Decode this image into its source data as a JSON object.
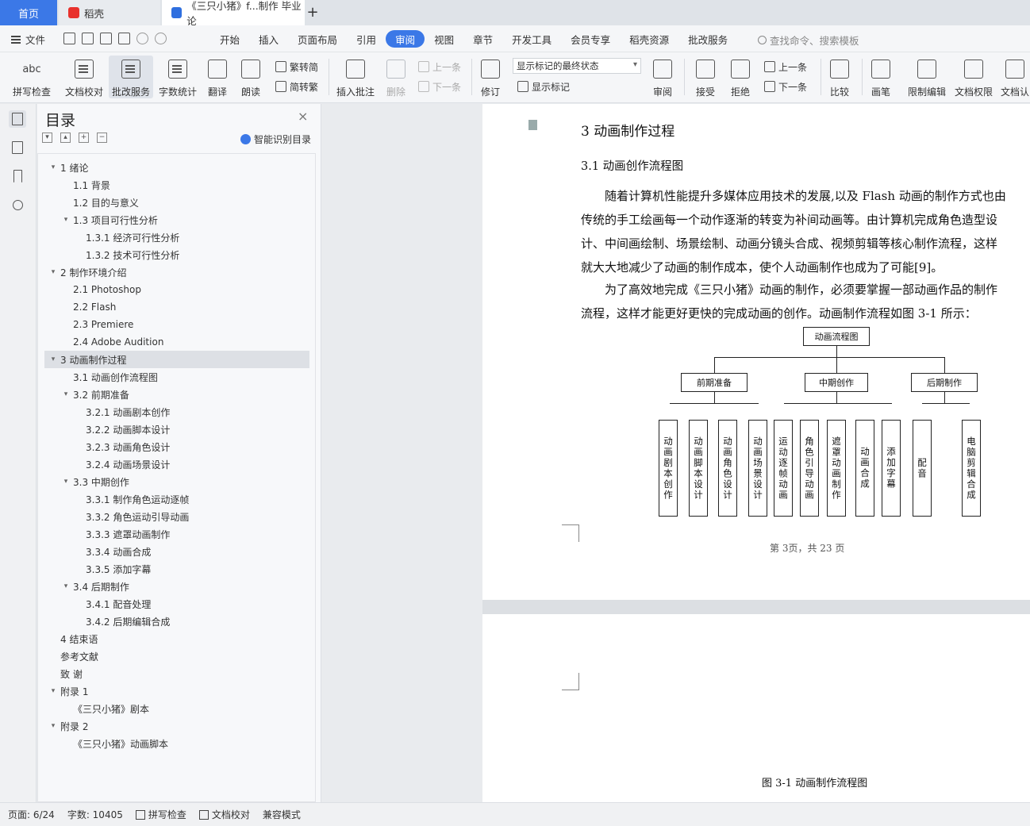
{
  "tabs": {
    "home": "首页",
    "docer": "稻壳",
    "document": "《三只小猪》f...制作 毕业论"
  },
  "menu": {
    "file": "文件",
    "items": [
      "开始",
      "插入",
      "页面布局",
      "引用",
      "审阅",
      "视图",
      "章节",
      "开发工具",
      "会员专享",
      "稻壳资源",
      "批改服务"
    ],
    "active": "审阅",
    "search": "查找命令、搜索模板"
  },
  "ribbon": {
    "spell_check": "拼写检查",
    "doc_proof": "文档校对",
    "review_service": "批改服务",
    "word_count": "字数统计",
    "translate": "翻译",
    "read_aloud": "朗读",
    "trad_to_simp": "繁转简",
    "simp_to_trad": "简转繁",
    "insert_comment": "插入批注",
    "delete": "删除",
    "prev": "上一条",
    "next": "下一条",
    "track_changes": "修订",
    "markup_state": "显示标记的最终状态",
    "show_markup": "显示标记",
    "review_pane": "审阅",
    "accept": "接受",
    "reject": "拒绝",
    "prev2": "上一条",
    "next2": "下一条",
    "compare": "比较",
    "ink": "画笔",
    "restrict_edit": "限制编辑",
    "doc_permission": "文档权限",
    "doc_cert": "文档认"
  },
  "toc": {
    "title": "目录",
    "smart": "智能识别目录",
    "items": [
      {
        "text": "1  绪论",
        "level": 1,
        "arrow": "v"
      },
      {
        "text": "1.1  背景",
        "level": 2
      },
      {
        "text": "1.2  目的与意义",
        "level": 2
      },
      {
        "text": "1.3  项目可行性分析",
        "level": 2,
        "arrow": "v"
      },
      {
        "text": "1.3.1  经济可行性分析",
        "level": 3
      },
      {
        "text": "1.3.2  技术可行性分析",
        "level": 3
      },
      {
        "text": "2  制作环境介绍",
        "level": 1,
        "arrow": "v"
      },
      {
        "text": "2.1 Photoshop",
        "level": 2
      },
      {
        "text": "2.2 Flash",
        "level": 2
      },
      {
        "text": "2.3 Premiere",
        "level": 2
      },
      {
        "text": "2.4 Adobe Audition",
        "level": 2
      },
      {
        "text": "3  动画制作过程",
        "level": 1,
        "arrow": "v",
        "active": true
      },
      {
        "text": "3.1  动画创作流程图",
        "level": 2
      },
      {
        "text": "3.2  前期准备",
        "level": 2,
        "arrow": "v"
      },
      {
        "text": "3.2.1 动画剧本创作",
        "level": 3
      },
      {
        "text": "3.2.2 动画脚本设计",
        "level": 3
      },
      {
        "text": "3.2.3 动画角色设计",
        "level": 3
      },
      {
        "text": "3.2.4 动画场景设计",
        "level": 3
      },
      {
        "text": "3.3  中期创作",
        "level": 2,
        "arrow": "v"
      },
      {
        "text": "3.3.1  制作角色运动逐帧",
        "level": 3
      },
      {
        "text": "3.3.2  角色运动引导动画",
        "level": 3
      },
      {
        "text": "3.3.3  遮罩动画制作",
        "level": 3
      },
      {
        "text": "3.3.4  动画合成",
        "level": 3
      },
      {
        "text": "3.3.5  添加字幕",
        "level": 3
      },
      {
        "text": "3.4  后期制作",
        "level": 2,
        "arrow": "v"
      },
      {
        "text": "3.4.1  配音处理",
        "level": 3
      },
      {
        "text": "3.4.2  后期编辑合成",
        "level": 3
      },
      {
        "text": "4 结束语",
        "level": 1
      },
      {
        "text": "参考文献",
        "level": 1
      },
      {
        "text": "致     谢",
        "level": 1
      },
      {
        "text": "附录 1",
        "level": 1,
        "arrow": "v"
      },
      {
        "text": "《三只小猪》剧本",
        "level": 2
      },
      {
        "text": "附录 2",
        "level": 1,
        "arrow": "v"
      },
      {
        "text": "《三只小猪》动画脚本",
        "level": 2
      }
    ]
  },
  "document": {
    "heading": "3  动画制作过程",
    "subheading": "3.1  动画创作流程图",
    "para1_lines": [
      "随着计算机性能提升多媒体应用技术的发展,以及 Flash 动画的制作方式也由",
      "传统的手工绘画每一个动作逐渐的转变为补间动画等。由计算机完成角色造型设",
      "计、中间画绘制、场景绘制、动画分镜头合成、视频剪辑等核心制作流程，这样",
      "就大大地减少了动画的制作成本，使个人动画制作也成为了可能[9]。"
    ],
    "para2_lines": [
      "为了高效地完成《三只小猪》动画的制作，必须要掌握一部动画作品的制作",
      "流程，这样才能更好更快的完成动画的创作。动画制作流程如图 3-1 所示："
    ],
    "page_footer": "第 3页，共 23 页",
    "caption": "图 3-1  动画制作流程图"
  },
  "flowchart": {
    "root": "动画流程图",
    "groups": [
      "前期准备",
      "中期创作",
      "后期制作"
    ],
    "leaves": [
      "动画剧本创作",
      "动画脚本设计",
      "动画角色设计",
      "动画场景设计",
      "运动逐帧动画",
      "角色引导动画",
      "遮罩动画制作",
      "动画合成",
      "添加字幕",
      "配音",
      "电脑剪辑合成"
    ]
  },
  "status": {
    "page": "页面: 6/24",
    "words": "字数: 10405",
    "spell": "拼写检查",
    "proof": "文档校对",
    "compat": "兼容模式"
  },
  "colors": {
    "accent": "#3b78e7",
    "docer_red": "#e8312c"
  }
}
